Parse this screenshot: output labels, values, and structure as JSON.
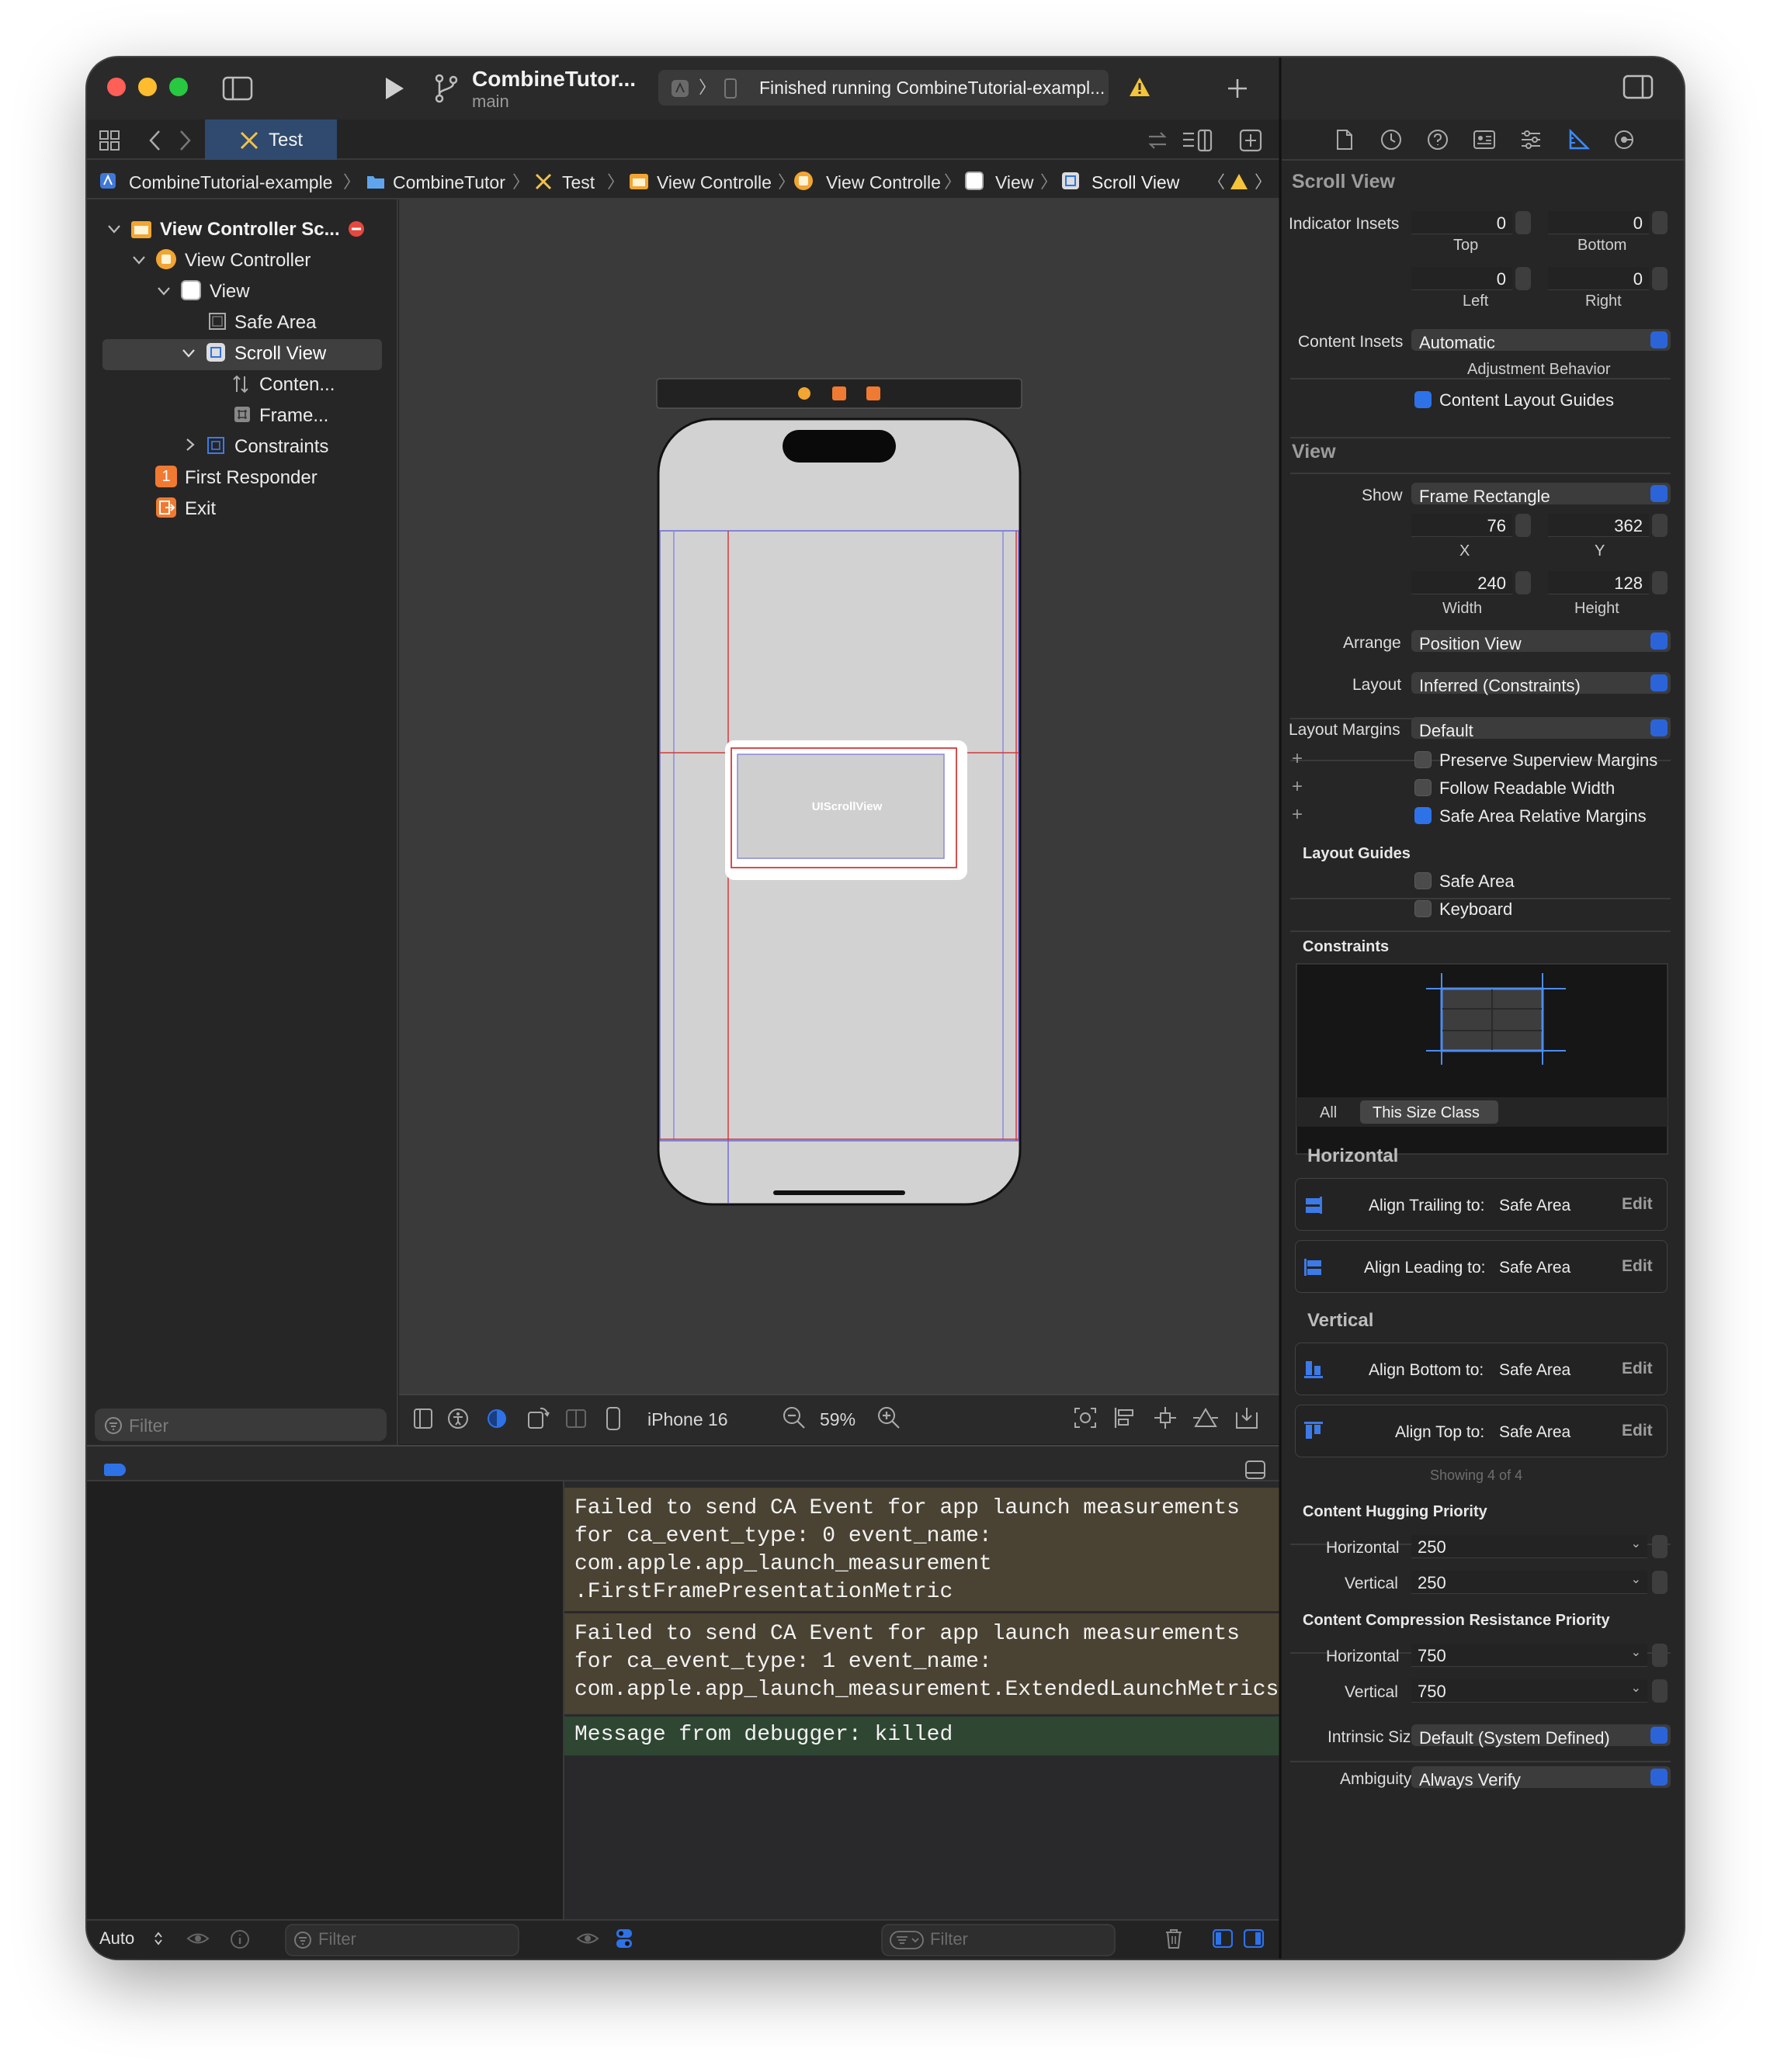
{
  "toolbar": {
    "scheme_title": "CombineTutor...",
    "branch": "main",
    "status": "Finished running CombineTutorial-exampl..."
  },
  "tab": {
    "label": "Test"
  },
  "breadcrumb": [
    "CombineTutorial-example",
    "CombineTutor",
    "Test",
    "View Controlle",
    "View Controlle",
    "View",
    "Scroll View"
  ],
  "outline": [
    "View Controller Sc...",
    "View Controller",
    "View",
    "Safe Area",
    "Scroll View",
    "Conten...",
    "Frame...",
    "Constraints",
    "First Responder",
    "Exit"
  ],
  "filters": {
    "navigator": "Filter",
    "variables": "Filter",
    "console": "Filter"
  },
  "canvas": {
    "scroll_label": "UIScrollView",
    "device": "iPhone 16",
    "zoom": "59%",
    "badge_1": "1"
  },
  "debug": {
    "auto": "Auto"
  },
  "console": [
    "Failed to send CA Event for app launch measurements\nfor ca_event_type: 0 event_name:\ncom.apple.app_launch_measurement\n.FirstFramePresentationMetric",
    "Failed to send CA Event for app launch measurements\nfor ca_event_type: 1 event_name:\ncom.apple.app_launch_measurement.ExtendedLaunchMetrics",
    "Message from debugger: killed"
  ],
  "inspector": {
    "scroll_section": "Scroll View",
    "indicator_insets_label": "Indicator Insets",
    "insets": {
      "top": "0",
      "bottom": "0",
      "left": "0",
      "right": "0"
    },
    "top_label": "Top",
    "bottom_label": "Bottom",
    "left_label": "Left",
    "right_label": "Right",
    "content_insets_label": "Content Insets",
    "content_insets_value": "Automatic",
    "adjustment_behavior": "Adjustment Behavior",
    "content_layout_guides": "Content Layout Guides",
    "view_section": "View",
    "show_label": "Show",
    "show_value": "Frame Rectangle",
    "x": "76",
    "y": "362",
    "width": "240",
    "height": "128",
    "x_label": "X",
    "y_label": "Y",
    "width_label": "Width",
    "height_label": "Height",
    "arrange_label": "Arrange",
    "arrange_value": "Position View",
    "layout_label": "Layout",
    "layout_value": "Inferred (Constraints)",
    "layout_margins_label": "Layout Margins",
    "layout_margins_value": "Default",
    "preserve_superview": "Preserve Superview Margins",
    "follow_readable": "Follow Readable Width",
    "safe_area_relative": "Safe Area Relative Margins",
    "layout_guides_title": "Layout Guides",
    "safe_area": "Safe Area",
    "keyboard": "Keyboard",
    "constraints_title": "Constraints",
    "seg_all": "All",
    "seg_size_class": "This Size Class",
    "horizontal_title": "Horizontal",
    "vertical_title": "Vertical",
    "constraints": [
      {
        "label": "Align Trailing to:",
        "target": "Safe Area",
        "edit": "Edit"
      },
      {
        "label": "Align Leading to:",
        "target": "Safe Area",
        "edit": "Edit"
      },
      {
        "label": "Align Bottom to:",
        "target": "Safe Area",
        "edit": "Edit"
      },
      {
        "label": "Align Top to:",
        "target": "Safe Area",
        "edit": "Edit"
      }
    ],
    "showing": "Showing 4 of 4",
    "hugging_title": "Content Hugging Priority",
    "hug_h_label": "Horizontal",
    "hug_h": "250",
    "hug_v_label": "Vertical",
    "hug_v": "250",
    "compression_title": "Content Compression Resistance Priority",
    "comp_h_label": "Horizontal",
    "comp_h": "750",
    "comp_v_label": "Vertical",
    "comp_v": "750",
    "intrinsic_label": "Intrinsic Size",
    "intrinsic_value": "Default (System Defined)",
    "ambiguity_label": "Ambiguity",
    "ambiguity_value": "Always Verify"
  },
  "colors": {
    "accent": "#2e72e8",
    "constraint_red": "#d23a3a",
    "window_bg": "#1e1e1e"
  }
}
